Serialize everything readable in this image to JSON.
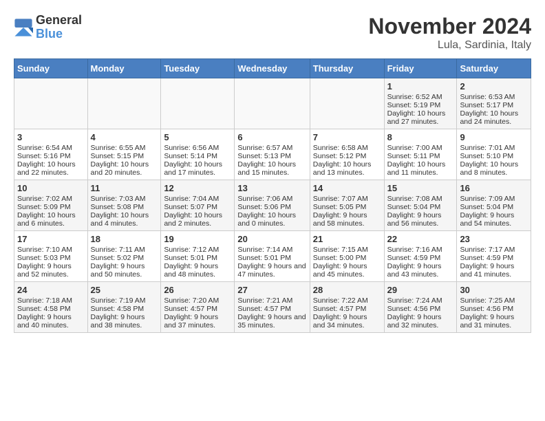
{
  "header": {
    "logo_general": "General",
    "logo_blue": "Blue",
    "month_title": "November 2024",
    "location": "Lula, Sardinia, Italy"
  },
  "weekdays": [
    "Sunday",
    "Monday",
    "Tuesday",
    "Wednesday",
    "Thursday",
    "Friday",
    "Saturday"
  ],
  "weeks": [
    [
      {
        "day": "",
        "info": ""
      },
      {
        "day": "",
        "info": ""
      },
      {
        "day": "",
        "info": ""
      },
      {
        "day": "",
        "info": ""
      },
      {
        "day": "",
        "info": ""
      },
      {
        "day": "1",
        "info": "Sunrise: 6:52 AM\nSunset: 5:19 PM\nDaylight: 10 hours and 27 minutes."
      },
      {
        "day": "2",
        "info": "Sunrise: 6:53 AM\nSunset: 5:17 PM\nDaylight: 10 hours and 24 minutes."
      }
    ],
    [
      {
        "day": "3",
        "info": "Sunrise: 6:54 AM\nSunset: 5:16 PM\nDaylight: 10 hours and 22 minutes."
      },
      {
        "day": "4",
        "info": "Sunrise: 6:55 AM\nSunset: 5:15 PM\nDaylight: 10 hours and 20 minutes."
      },
      {
        "day": "5",
        "info": "Sunrise: 6:56 AM\nSunset: 5:14 PM\nDaylight: 10 hours and 17 minutes."
      },
      {
        "day": "6",
        "info": "Sunrise: 6:57 AM\nSunset: 5:13 PM\nDaylight: 10 hours and 15 minutes."
      },
      {
        "day": "7",
        "info": "Sunrise: 6:58 AM\nSunset: 5:12 PM\nDaylight: 10 hours and 13 minutes."
      },
      {
        "day": "8",
        "info": "Sunrise: 7:00 AM\nSunset: 5:11 PM\nDaylight: 10 hours and 11 minutes."
      },
      {
        "day": "9",
        "info": "Sunrise: 7:01 AM\nSunset: 5:10 PM\nDaylight: 10 hours and 8 minutes."
      }
    ],
    [
      {
        "day": "10",
        "info": "Sunrise: 7:02 AM\nSunset: 5:09 PM\nDaylight: 10 hours and 6 minutes."
      },
      {
        "day": "11",
        "info": "Sunrise: 7:03 AM\nSunset: 5:08 PM\nDaylight: 10 hours and 4 minutes."
      },
      {
        "day": "12",
        "info": "Sunrise: 7:04 AM\nSunset: 5:07 PM\nDaylight: 10 hours and 2 minutes."
      },
      {
        "day": "13",
        "info": "Sunrise: 7:06 AM\nSunset: 5:06 PM\nDaylight: 10 hours and 0 minutes."
      },
      {
        "day": "14",
        "info": "Sunrise: 7:07 AM\nSunset: 5:05 PM\nDaylight: 9 hours and 58 minutes."
      },
      {
        "day": "15",
        "info": "Sunrise: 7:08 AM\nSunset: 5:04 PM\nDaylight: 9 hours and 56 minutes."
      },
      {
        "day": "16",
        "info": "Sunrise: 7:09 AM\nSunset: 5:04 PM\nDaylight: 9 hours and 54 minutes."
      }
    ],
    [
      {
        "day": "17",
        "info": "Sunrise: 7:10 AM\nSunset: 5:03 PM\nDaylight: 9 hours and 52 minutes."
      },
      {
        "day": "18",
        "info": "Sunrise: 7:11 AM\nSunset: 5:02 PM\nDaylight: 9 hours and 50 minutes."
      },
      {
        "day": "19",
        "info": "Sunrise: 7:12 AM\nSunset: 5:01 PM\nDaylight: 9 hours and 48 minutes."
      },
      {
        "day": "20",
        "info": "Sunrise: 7:14 AM\nSunset: 5:01 PM\nDaylight: 9 hours and 47 minutes."
      },
      {
        "day": "21",
        "info": "Sunrise: 7:15 AM\nSunset: 5:00 PM\nDaylight: 9 hours and 45 minutes."
      },
      {
        "day": "22",
        "info": "Sunrise: 7:16 AM\nSunset: 4:59 PM\nDaylight: 9 hours and 43 minutes."
      },
      {
        "day": "23",
        "info": "Sunrise: 7:17 AM\nSunset: 4:59 PM\nDaylight: 9 hours and 41 minutes."
      }
    ],
    [
      {
        "day": "24",
        "info": "Sunrise: 7:18 AM\nSunset: 4:58 PM\nDaylight: 9 hours and 40 minutes."
      },
      {
        "day": "25",
        "info": "Sunrise: 7:19 AM\nSunset: 4:58 PM\nDaylight: 9 hours and 38 minutes."
      },
      {
        "day": "26",
        "info": "Sunrise: 7:20 AM\nSunset: 4:57 PM\nDaylight: 9 hours and 37 minutes."
      },
      {
        "day": "27",
        "info": "Sunrise: 7:21 AM\nSunset: 4:57 PM\nDaylight: 9 hours and 35 minutes."
      },
      {
        "day": "28",
        "info": "Sunrise: 7:22 AM\nSunset: 4:57 PM\nDaylight: 9 hours and 34 minutes."
      },
      {
        "day": "29",
        "info": "Sunrise: 7:24 AM\nSunset: 4:56 PM\nDaylight: 9 hours and 32 minutes."
      },
      {
        "day": "30",
        "info": "Sunrise: 7:25 AM\nSunset: 4:56 PM\nDaylight: 9 hours and 31 minutes."
      }
    ]
  ]
}
